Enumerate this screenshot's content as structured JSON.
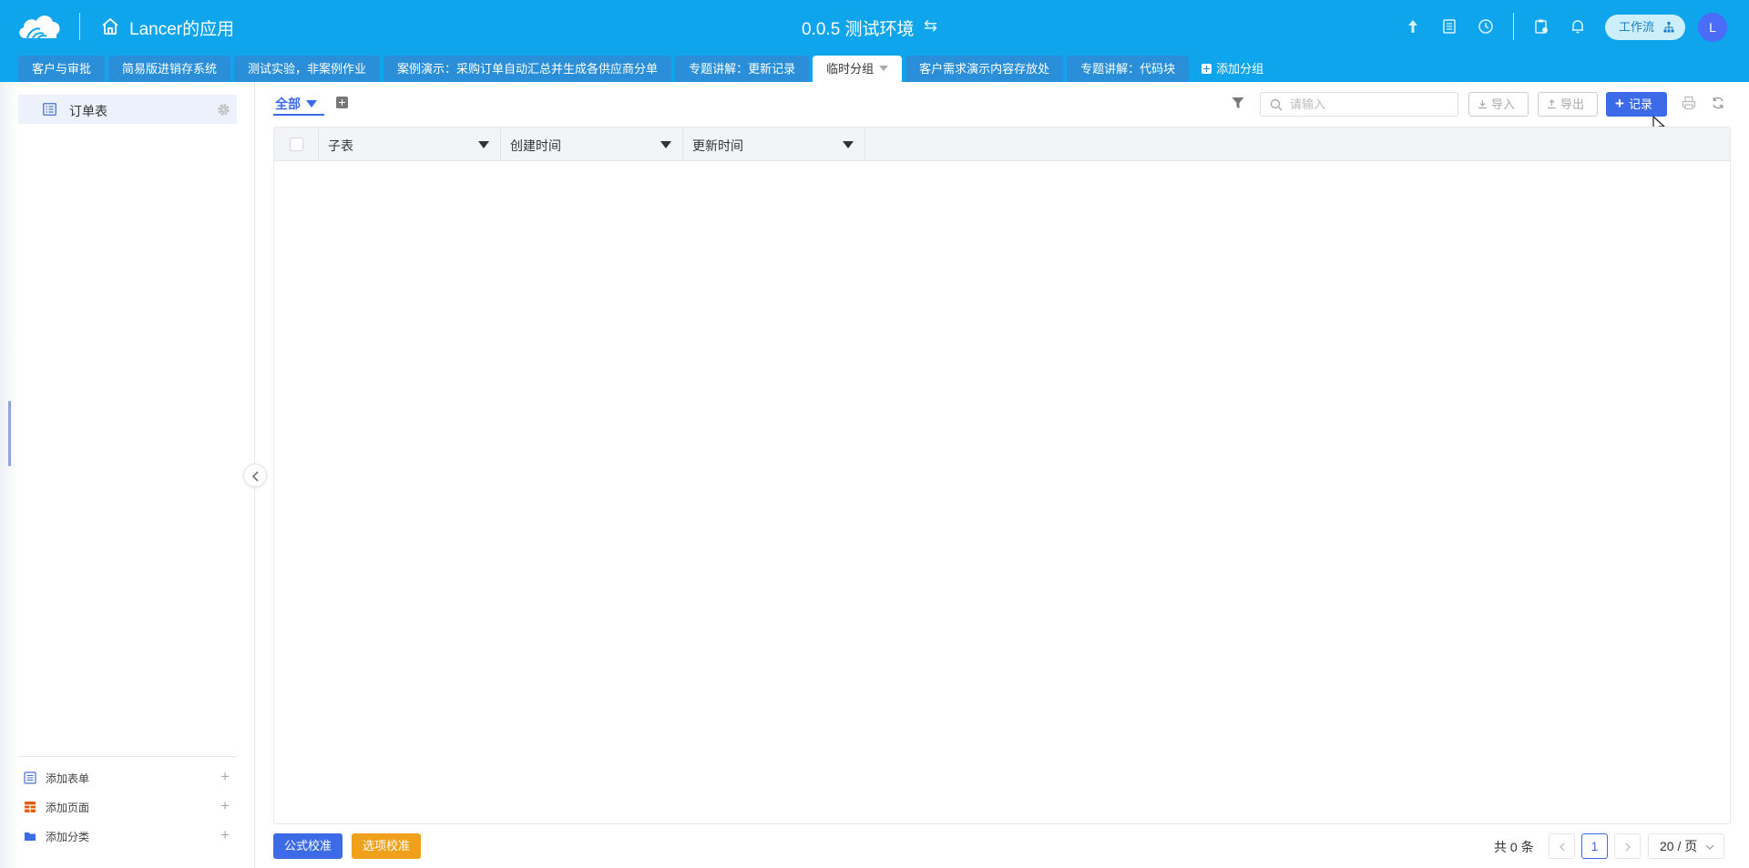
{
  "header": {
    "app_title": "Lancer的应用",
    "env_title": "0.0.5 测试环境",
    "swap_symbol": "⇆",
    "workflow_label": "工作流",
    "avatar_letter": "L",
    "colors": {
      "brand": "#0ea5ec",
      "accent": "#3d6be8"
    }
  },
  "tabs": [
    {
      "label": "客户与审批"
    },
    {
      "label": "简易版进销存系统"
    },
    {
      "label": "测试实验，非案例作业"
    },
    {
      "label": "案例演示：采购订单自动汇总并生成各供应商分单"
    },
    {
      "label": "专题讲解：更新记录"
    },
    {
      "label": "临时分组",
      "active": true
    },
    {
      "label": "客户需求演示内容存放处"
    },
    {
      "label": "专题讲解：代码块"
    }
  ],
  "add_group_label": "添加分组",
  "sidebar": {
    "items": [
      {
        "label": "订单表"
      }
    ],
    "bottom": [
      {
        "label": "添加表单",
        "plus": "+"
      },
      {
        "label": "添加页面",
        "plus": "+"
      },
      {
        "label": "添加分类",
        "plus": "+"
      }
    ]
  },
  "toolbar": {
    "view_label": "全部",
    "search_placeholder": "请输入",
    "import_label": "导入",
    "export_label": "导出",
    "record_plus": "+",
    "record_label": "记录"
  },
  "table": {
    "columns": [
      {
        "label": "子表"
      },
      {
        "label": "创建时间"
      },
      {
        "label": "更新时间"
      }
    ],
    "rows": []
  },
  "footer": {
    "formula_btn": "公式校准",
    "option_btn": "选项校准",
    "total": "共 0 条",
    "current_page": "1",
    "page_size": "20 / 页"
  }
}
